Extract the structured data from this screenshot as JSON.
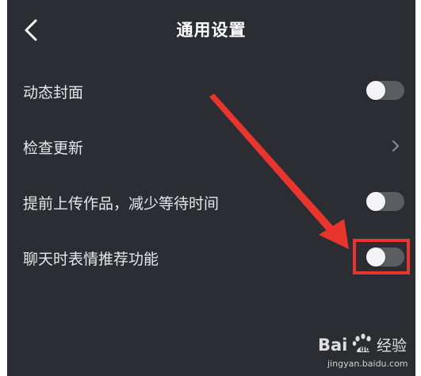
{
  "header": {
    "title": "通用设置",
    "back_icon": "chevron-left-icon"
  },
  "settings": [
    {
      "label": "动态封面",
      "control": "toggle",
      "enabled": false
    },
    {
      "label": "检查更新",
      "control": "chevron"
    },
    {
      "label": "提前上传作品，减少等待时间",
      "control": "toggle",
      "enabled": false
    },
    {
      "label": "聊天时表情推荐功能",
      "control": "toggle",
      "enabled": false
    }
  ],
  "annotation": {
    "arrow_color": "#e8352e",
    "box_color": "#e8352e"
  },
  "watermark": {
    "logo_text": "Bai du 经验",
    "url": "jingyan.baidu.com"
  },
  "colors": {
    "background": "#2c2d33",
    "toggle_track": "#5c5d63",
    "toggle_knob": "#f4f4f6",
    "accent_red": "#e8352e"
  }
}
